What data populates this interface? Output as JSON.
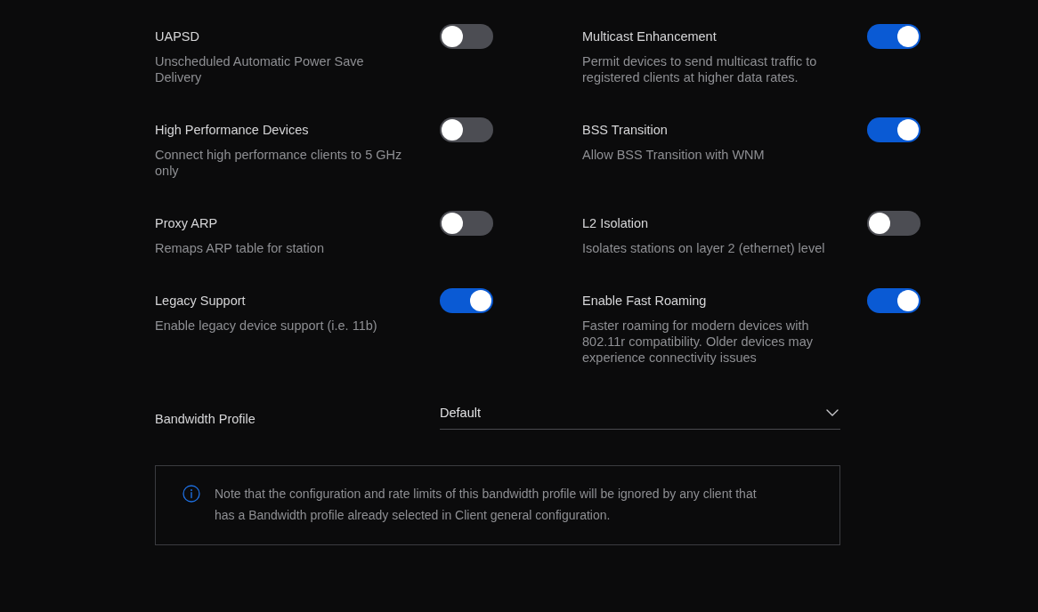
{
  "settings": [
    {
      "title": "UAPSD",
      "description": "Unscheduled Automatic Power Save Delivery",
      "on": false
    },
    {
      "title": "Multicast Enhancement",
      "description": "Permit devices to send multicast traffic to registered clients at higher data rates.",
      "on": true
    },
    {
      "title": "High Performance Devices",
      "description": "Connect high performance clients to 5 GHz only",
      "on": false
    },
    {
      "title": "BSS Transition",
      "description": "Allow BSS Transition with WNM",
      "on": true
    },
    {
      "title": "Proxy ARP",
      "description": "Remaps ARP table for station",
      "on": false
    },
    {
      "title": "L2 Isolation",
      "description": "Isolates stations on layer 2 (ethernet) level",
      "on": false
    },
    {
      "title": "Legacy Support",
      "description": "Enable legacy device support (i.e. 11b)",
      "on": true
    },
    {
      "title": "Enable Fast Roaming",
      "description": "Faster roaming for modern devices with 802.11r compatibility. Older devices may experience connectivity issues",
      "on": true
    }
  ],
  "bandwidth_profile": {
    "label": "Bandwidth Profile",
    "value": "Default"
  },
  "note": {
    "text": "Note that the configuration and rate limits of this bandwidth profile will be ignored by any client that has a Bandwidth profile already selected in Client general configuration."
  }
}
